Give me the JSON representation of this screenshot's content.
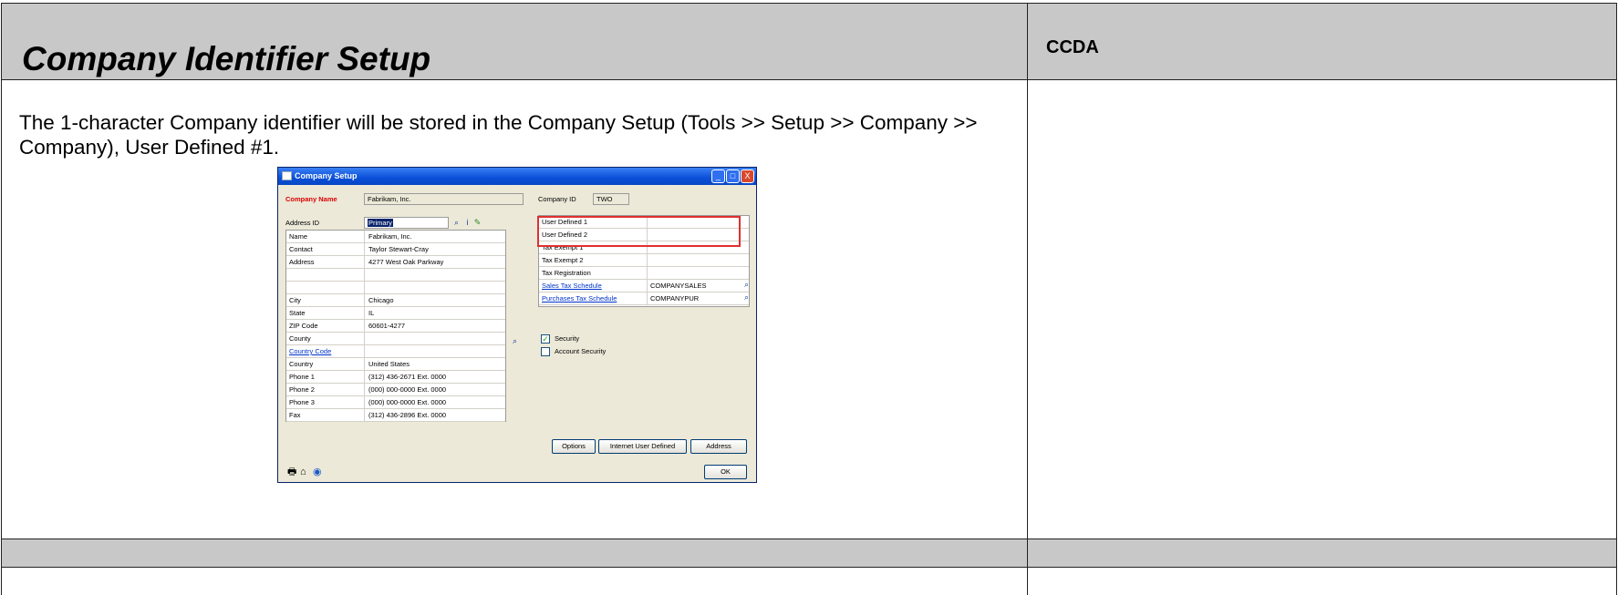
{
  "header": {
    "title": "Company Identifier Setup",
    "right_label": "CCDA"
  },
  "body": {
    "text": "The 1-character Company identifier will be stored in the Company Setup (Tools >> Setup >> Company >> Company), User Defined #1."
  },
  "dialog": {
    "title": "Company Setup",
    "company_name_label": "Company Name",
    "company_name_value": "Fabrikam, Inc.",
    "company_id_label": "Company ID",
    "company_id_value": "TWO",
    "address_id_label": "Address ID",
    "address_id_value": "Primary",
    "address_rows": [
      {
        "label": "Name",
        "value": "Fabrikam, Inc."
      },
      {
        "label": "Contact",
        "value": "Taylor Stewart-Cray"
      },
      {
        "label": "Address",
        "value": "4277 West Oak Parkway"
      },
      {
        "label": "",
        "value": ""
      },
      {
        "label": "",
        "value": ""
      },
      {
        "label": "City",
        "value": "Chicago"
      },
      {
        "label": "State",
        "value": "IL"
      },
      {
        "label": "ZIP Code",
        "value": "60601-4277"
      },
      {
        "label": "County",
        "value": ""
      },
      {
        "label": "Country Code",
        "value": ""
      },
      {
        "label": "Country",
        "value": "United States"
      },
      {
        "label": "Phone 1",
        "value": "(312) 436-2671  Ext. 0000"
      },
      {
        "label": "Phone 2",
        "value": "(000) 000-0000  Ext. 0000"
      },
      {
        "label": "Phone 3",
        "value": "(000) 000-0000  Ext. 0000"
      },
      {
        "label": "Fax",
        "value": "(312) 436-2896  Ext. 0000"
      }
    ],
    "right_rows": [
      {
        "label": "User Defined 1",
        "value": ""
      },
      {
        "label": "User Defined 2",
        "value": ""
      },
      {
        "label": "Tax Exempt 1",
        "value": ""
      },
      {
        "label": "Tax Exempt 2",
        "value": ""
      },
      {
        "label": "Tax Registration",
        "value": ""
      },
      {
        "label": "Sales Tax Schedule",
        "value": "COMPANYSALES"
      },
      {
        "label": "Purchases Tax Schedule",
        "value": "COMPANYPUR"
      }
    ],
    "security_label": "Security",
    "security_checked": true,
    "account_security_label": "Account Security",
    "account_security_checked": false,
    "buttons": {
      "options": "Options",
      "internet_user_defined": "Internet User Defined",
      "address": "Address",
      "ok": "OK"
    },
    "window_buttons": {
      "minimize": "_",
      "maximize": "□",
      "close": "X"
    },
    "highlight_color": "#e03030",
    "title_bar_color": "#0a4fd8",
    "icons": [
      "lookup-icon",
      "info-icon",
      "note-icon",
      "printer-icon",
      "attach-icon",
      "help-icon"
    ]
  },
  "colors": {
    "header_bg": "#c8c8c8",
    "label_required": "#dd0000",
    "link": "#0033cc"
  }
}
